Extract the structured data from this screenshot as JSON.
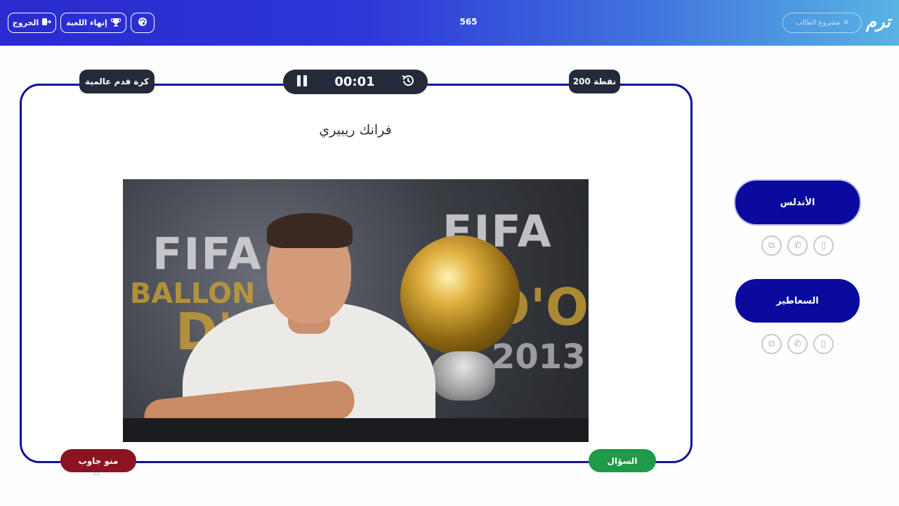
{
  "topbar": {
    "exit_label": "الخروج",
    "end_game_label": "إنهاء اللعبة",
    "score": "565",
    "right_pill_label": "مشروع الطالب",
    "logo_text": "ترم"
  },
  "game": {
    "category": "كرة قدم عالمية",
    "points": "200 نقطة",
    "timer": "00:01",
    "question": "فرانك ريبيري",
    "who_answered_label": "منو جاوب",
    "question_label": "السؤال"
  },
  "teams": [
    {
      "name": "الأندلس"
    },
    {
      "name": "السعاطير"
    }
  ],
  "photo": {
    "fifa": "FIFA",
    "ballon": "BALLON",
    "dor": "D'OR",
    "year": "2013"
  },
  "colors": {
    "frame": "#12129a",
    "team_button": "#0a0a9e",
    "answer_button": "#8c1422",
    "question_button": "#1e9a48",
    "badge": "#232b3a"
  },
  "icons": {
    "exit": "exit-icon",
    "end_game": "trophy-icon",
    "palette": "palette-icon",
    "pause": "pause-icon",
    "reset": "history-icon",
    "aid_double": "double-answer-icon",
    "aid_call": "phone-icon",
    "aid_hole": "hole-icon"
  }
}
